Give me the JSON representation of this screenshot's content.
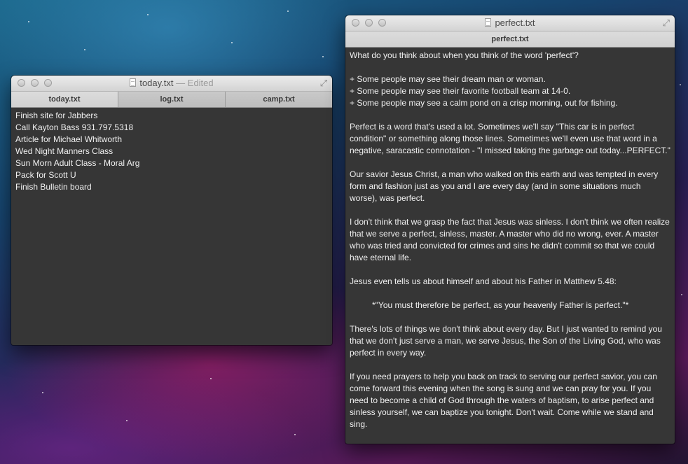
{
  "window_left": {
    "title": "today.txt",
    "edited_label": "— Edited",
    "tabs": [
      {
        "label": "today.txt"
      },
      {
        "label": "log.txt"
      },
      {
        "label": "camp.txt"
      }
    ],
    "lines": [
      "Finish site for Jabbers",
      "Call Kayton Bass 931.797.5318",
      "Article for Michael Whitworth",
      "Wed Night Manners Class",
      "Sun Morn Adult Class - Moral Arg",
      "Pack for Scott U",
      "Finish Bulletin board"
    ]
  },
  "window_right": {
    "title": "perfect.txt",
    "tabs": [
      {
        "label": "perfect.txt"
      }
    ],
    "paragraphs": [
      "What do you think about when you think of the word 'perfect'?",
      "+ Some people may see their dream man or woman.",
      "+ Some people may see their favorite football team at 14-0.",
      "+ Some people may see a calm pond on a crisp morning, out for fishing.",
      "Perfect is a word that's used a lot. Sometimes we'll say \"This car is in perfect condition\" or something along those lines. Sometimes we'll even use that word in a negative, saracastic connotation - \"I missed taking the garbage out today...PERFECT.\"",
      "Our savior Jesus Christ, a man who walked on this earth and was tempted in every form and fashion just as you and I are every day (and in some situations much worse), was perfect.",
      "I don't think that we grasp the fact that Jesus was sinless. I don't think we often realize that we serve a perfect, sinless, master. A master who did no wrong, ever. A master who was tried and convicted for crimes and sins he didn't commit so that we could have eternal life.",
      "Jesus even tells us about himself and about his Father in Matthew 5.48:",
      "*\"You must therefore be perfect, as your heavenly Father is perfect.\"*",
      "There's lots of things we don't think about every day. But I just wanted to remind you that we don't just serve a man, we serve Jesus, the Son of the Living God, who was perfect in every way.",
      "If you need prayers to help you back on track to serving our perfect savior, you can come forward this evening when the song is sung and we can pray for you. If you need to become a child of God through the waters of baptism, to arise perfect and sinless yourself, we can baptize you tonight. Don't wait. Come while we stand and sing."
    ]
  }
}
